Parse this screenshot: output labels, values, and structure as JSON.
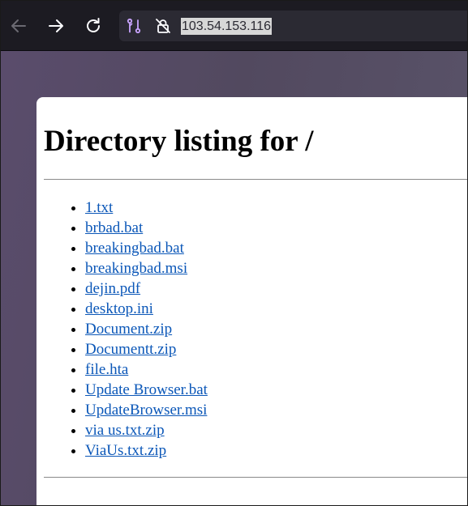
{
  "browser": {
    "back_icon": "arrow-left-icon",
    "forward_icon": "arrow-right-icon",
    "reload_icon": "reload-icon",
    "site_icon": "connection-icon",
    "lock_icon": "insecure-lock-icon",
    "address": "103.54.153.116"
  },
  "page": {
    "heading": "Directory listing for /",
    "files": [
      "1.txt",
      "brbad.bat",
      "breakingbad.bat",
      "breakingbad.msi",
      "dejin.pdf",
      "desktop.ini",
      "Document.zip",
      "Documentt.zip",
      "file.hta",
      "Update Browser.bat",
      "UpdateBrowser.msi",
      "via us.txt.zip",
      "ViaUs.txt.zip"
    ]
  },
  "colors": {
    "toolbar": "#1c1b22",
    "urlbar": "#2b2a33",
    "link": "#0b57b8",
    "backdrop": "#5c5269"
  }
}
